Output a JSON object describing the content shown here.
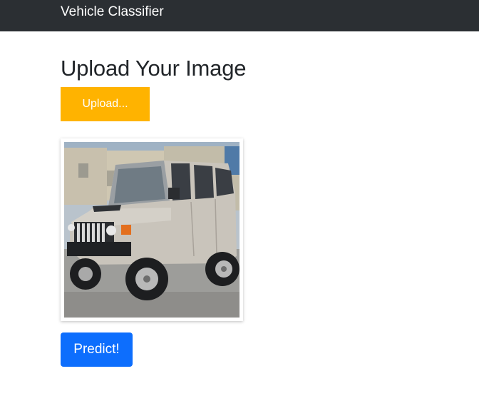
{
  "navbar": {
    "brand": "Vehicle Classifier"
  },
  "main": {
    "title": "Upload Your Image",
    "upload_label": "Upload...",
    "preview_image": "uploaded-suv-photo",
    "predict_label": "Predict!"
  },
  "colors": {
    "navbar_bg": "#2b2f33",
    "upload_button": "#ffb300",
    "predict_button": "#0d6efd"
  }
}
